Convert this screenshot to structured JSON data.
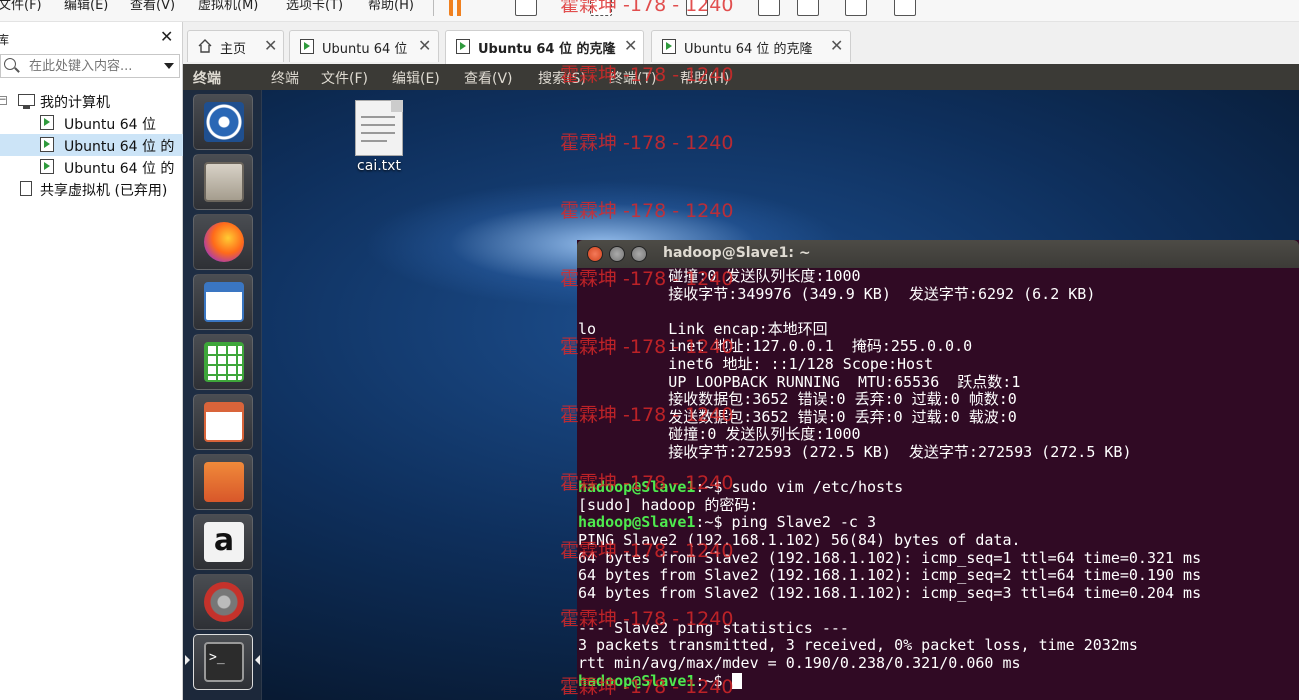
{
  "vmware": {
    "menus": [
      "文件(F)",
      "编辑(E)",
      "查看(V)",
      "虚拟机(M)",
      "选项卡(T)",
      "帮助(H)"
    ]
  },
  "library": {
    "title": "库",
    "search_placeholder": "在此处键入内容...",
    "tree": [
      {
        "label": "我的计算机"
      },
      {
        "label": "Ubuntu 64 位"
      },
      {
        "label": "Ubuntu 64 位 的"
      },
      {
        "label": "Ubuntu 64 位 的"
      },
      {
        "label": "共享虚拟机 (已弃用)"
      }
    ]
  },
  "tabs": [
    {
      "label": "主页"
    },
    {
      "label": "Ubuntu 64 位"
    },
    {
      "label": "Ubuntu 64 位 的克隆",
      "active": true
    },
    {
      "label": "Ubuntu 64 位 的克隆"
    }
  ],
  "guest": {
    "app_name": "终端",
    "menu": [
      "终端",
      "文件(F)",
      "编辑(E)",
      "查看(V)",
      "搜索(S)",
      "终端(T)",
      "帮助(H)"
    ],
    "desktop_file": "cai.txt",
    "launcher_items": [
      "ubuntu-dash",
      "files",
      "firefox",
      "writer",
      "calc",
      "impress",
      "software-center",
      "amazon",
      "system-settings",
      "terminal"
    ]
  },
  "terminal": {
    "title": "hadoop@Slave1: ~",
    "lines": [
      {
        "text": "          碰撞:0 发送队列长度:1000"
      },
      {
        "text": "          接收字节:349976 (349.9 KB)  发送字节:6292 (6.2 KB)"
      },
      {
        "text": ""
      },
      {
        "text": "lo        Link encap:本地环回"
      },
      {
        "text": "          inet 地址:127.0.0.1  掩码:255.0.0.0"
      },
      {
        "text": "          inet6 地址: ::1/128 Scope:Host"
      },
      {
        "text": "          UP LOOPBACK RUNNING  MTU:65536  跃点数:1"
      },
      {
        "text": "          接收数据包:3652 错误:0 丢弃:0 过载:0 帧数:0"
      },
      {
        "text": "          发送数据包:3652 错误:0 丢弃:0 过载:0 载波:0"
      },
      {
        "text": "          碰撞:0 发送队列长度:1000"
      },
      {
        "text": "          接收字节:272593 (272.5 KB)  发送字节:272593 (272.5 KB)"
      },
      {
        "text": ""
      },
      {
        "prompt": "hadoop@Slave1",
        "text": ":~$ sudo vim /etc/hosts"
      },
      {
        "text": "[sudo] hadoop 的密码:"
      },
      {
        "prompt": "hadoop@Slave1",
        "text": ":~$ ping Slave2 -c 3"
      },
      {
        "text": "PING Slave2 (192.168.1.102) 56(84) bytes of data."
      },
      {
        "text": "64 bytes from Slave2 (192.168.1.102): icmp_seq=1 ttl=64 time=0.321 ms"
      },
      {
        "text": "64 bytes from Slave2 (192.168.1.102): icmp_seq=2 ttl=64 time=0.190 ms"
      },
      {
        "text": "64 bytes from Slave2 (192.168.1.102): icmp_seq=3 ttl=64 time=0.204 ms"
      },
      {
        "text": ""
      },
      {
        "text": "--- Slave2 ping statistics ---"
      },
      {
        "text": "3 packets transmitted, 3 received, 0% packet loss, time 2032ms"
      },
      {
        "text": "rtt min/avg/max/mdev = 0.190/0.238/0.321/0.060 ms"
      },
      {
        "prompt": "hadoop@Slave1",
        "text": ":~$ ",
        "cursor": true
      }
    ]
  },
  "watermark": "霍霖坤 -178 - 1240"
}
